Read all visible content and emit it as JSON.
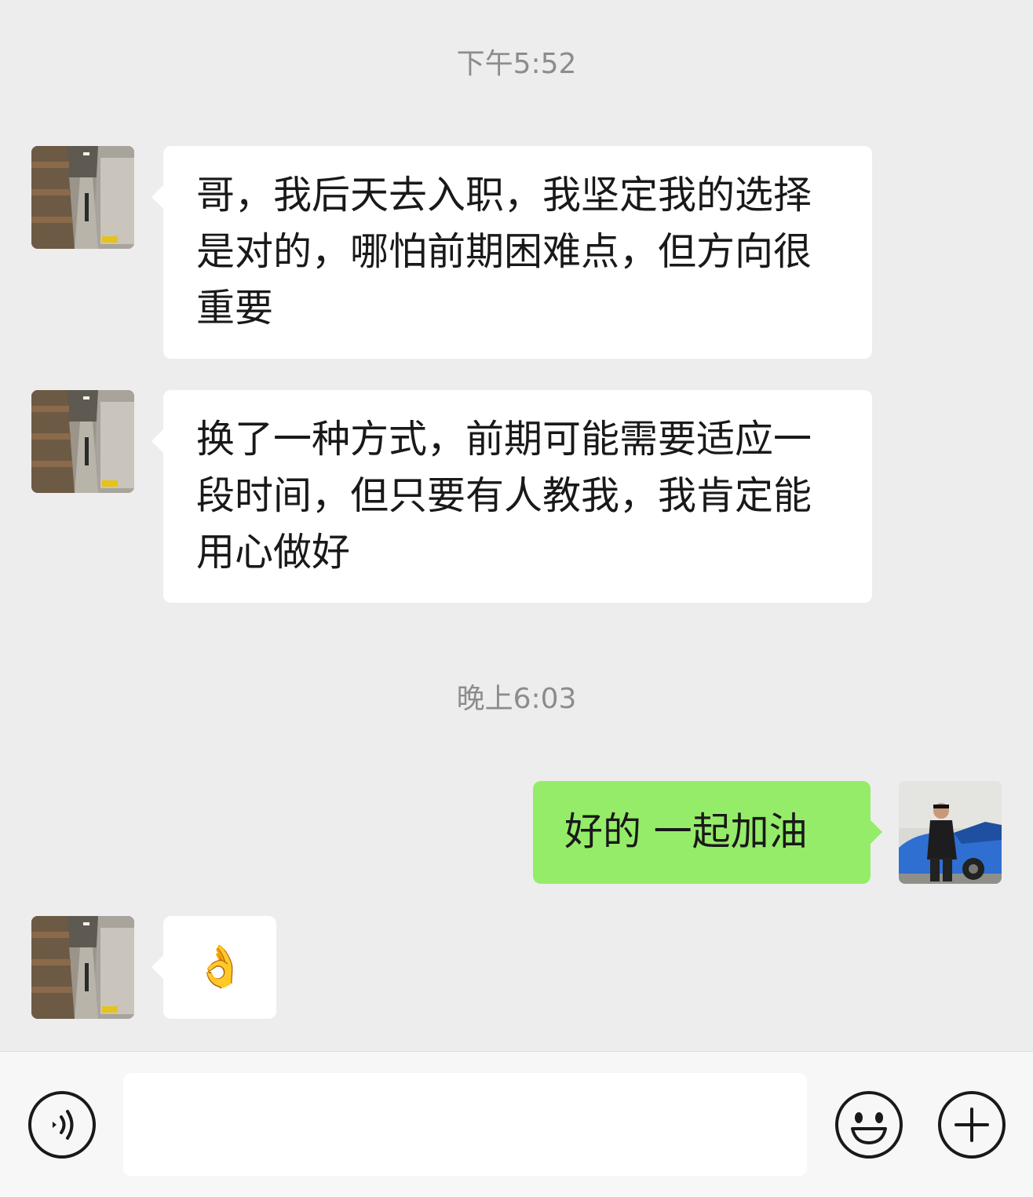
{
  "chat": {
    "timestamps": [
      "下午5:52",
      "晚上6:03"
    ],
    "messages": [
      {
        "sender": "contact",
        "text": "哥，我后天去入职，我坚定我的选择是对的，哪怕前期困难点，但方向很重要"
      },
      {
        "sender": "contact",
        "text": "换了一种方式，前期可能需要适应一段时间，但只要有人教我，我肯定能用心做好"
      },
      {
        "sender": "me",
        "text": "好的 一起加油"
      },
      {
        "sender": "contact",
        "text": "👌"
      }
    ]
  },
  "input_bar": {
    "value": "",
    "voice_icon": "voice-icon",
    "emoji_icon": "emoji-icon",
    "add_icon": "plus-icon"
  },
  "colors": {
    "background": "#ededed",
    "incoming_bubble": "#ffffff",
    "outgoing_bubble": "#95ec69",
    "timestamp_text": "#8c8c8c",
    "icon_stroke": "#191919"
  }
}
